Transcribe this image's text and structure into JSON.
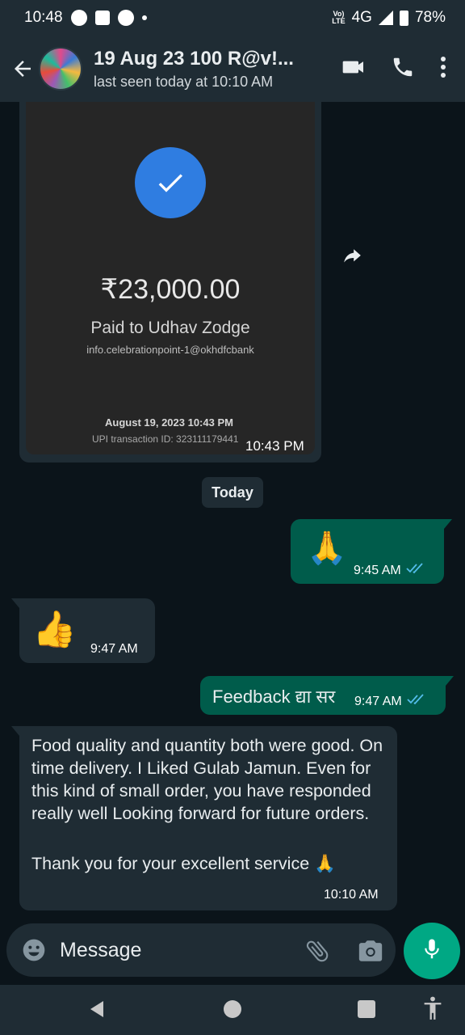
{
  "status_bar": {
    "time": "10:48",
    "network_label": "4G",
    "volte_label": "Vo)\nLTE",
    "battery": "78%"
  },
  "header": {
    "title": "19 Aug 23 100 R@v!...",
    "subtitle": "last seen today at 10:10 AM",
    "icons": [
      "back-arrow-icon",
      "video-call-icon",
      "voice-call-icon",
      "more-vert-icon"
    ]
  },
  "payment_card": {
    "amount": "₹23,000.00",
    "paid_to": "Paid to Udhav Zodge",
    "upi_id": "info.celebrationpoint-1@okhdfcbank",
    "date": "August 19, 2023 10:43 PM",
    "transaction_id": "UPI transaction ID: 323111179441",
    "time": "10:43 PM",
    "status_color": "#2f7de1"
  },
  "date_divider": "Today",
  "messages": [
    {
      "direction": "out",
      "text": "🙏",
      "time": "9:45 AM",
      "ticks": "read"
    },
    {
      "direction": "in",
      "text": "👍",
      "time": "9:47 AM"
    },
    {
      "direction": "out",
      "text": "Feedback द्या सर",
      "time": "9:47 AM",
      "ticks": "read"
    },
    {
      "direction": "in",
      "text": "Food quality and quantity both were good. On time delivery. I Liked Gulab Jamun. Even for this kind of small order, you have responded really well Looking forward for future orders.",
      "text2": "Thank you for your excellent service 🙏",
      "time": "10:10 AM"
    }
  ],
  "composer": {
    "placeholder": "Message"
  },
  "colors": {
    "background": "#0b141a",
    "bar": "#1f2c34",
    "outgoing_bubble": "#005c4b",
    "incoming_bubble": "#1f2c34",
    "accent": "#00a884",
    "read_ticks": "#53bdeb"
  }
}
